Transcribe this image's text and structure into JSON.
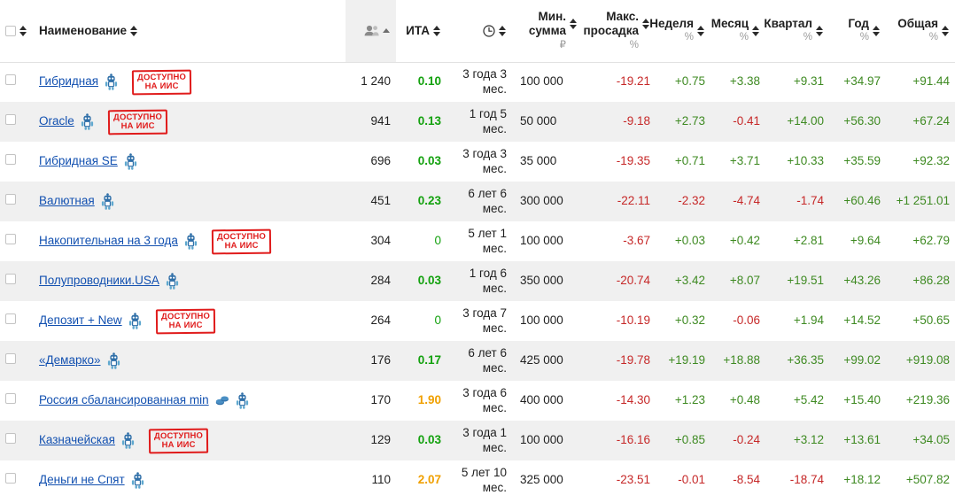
{
  "table": {
    "columns": [
      {
        "key": "select",
        "label": "",
        "sort": "both",
        "align": "left"
      },
      {
        "key": "name",
        "label": "Наименование",
        "sub": "",
        "sort": "both",
        "align": "left"
      },
      {
        "key": "people",
        "label": "",
        "icon": "people-icon",
        "sub": "",
        "sort": "asc",
        "align": "right",
        "sorted": true
      },
      {
        "key": "ita",
        "label": "ИТА",
        "sub": "",
        "sort": "both",
        "align": "right"
      },
      {
        "key": "term",
        "label": "",
        "icon": "clock-icon",
        "sub": "",
        "sort": "both",
        "align": "right"
      },
      {
        "key": "minsum",
        "label": "Мин. сумма",
        "sub": "₽",
        "sort": "both",
        "align": "right"
      },
      {
        "key": "maxdraw",
        "label": "Макс. просадка",
        "sub": "%",
        "sort": "both",
        "align": "right"
      },
      {
        "key": "week",
        "label": "Неделя",
        "sub": "%",
        "sort": "both",
        "align": "right"
      },
      {
        "key": "month",
        "label": "Месяц",
        "sub": "%",
        "sort": "both",
        "align": "right"
      },
      {
        "key": "quarter",
        "label": "Квартал",
        "sub": "%",
        "sort": "both",
        "align": "right"
      },
      {
        "key": "year",
        "label": "Год",
        "sub": "%",
        "sort": "both",
        "align": "right"
      },
      {
        "key": "total",
        "label": "Общая",
        "sub": "%",
        "sort": "both",
        "align": "right"
      }
    ],
    "badge_label_line1": "ДОСТУПНО",
    "badge_label_line2": "НА ИИС",
    "rows": [
      {
        "name": "Гибридная",
        "robot": true,
        "coins": false,
        "iis": true,
        "people": "1 240",
        "ita": "0.10",
        "ita_color": "green",
        "term": "3 года 3 мес.",
        "minsum": "100 000",
        "maxdraw": "-19.21",
        "week": "+0.75",
        "month": "+3.38",
        "quarter": "+9.31",
        "year": "+34.97",
        "total": "+91.44"
      },
      {
        "name": "Oracle",
        "robot": true,
        "coins": false,
        "iis": true,
        "people": "941",
        "ita": "0.13",
        "ita_color": "green",
        "term": "1 год 5 мес.",
        "minsum": "50 000",
        "maxdraw": "-9.18",
        "week": "+2.73",
        "month": "-0.41",
        "quarter": "+14.00",
        "year": "+56.30",
        "total": "+67.24"
      },
      {
        "name": "Гибридная SE",
        "robot": true,
        "coins": false,
        "iis": false,
        "people": "696",
        "ita": "0.03",
        "ita_color": "green",
        "term": "3 года 3 мес.",
        "minsum": "35 000",
        "maxdraw": "-19.35",
        "week": "+0.71",
        "month": "+3.71",
        "quarter": "+10.33",
        "year": "+35.59",
        "total": "+92.32"
      },
      {
        "name": "Валютная",
        "robot": true,
        "coins": false,
        "iis": false,
        "people": "451",
        "ita": "0.23",
        "ita_color": "green",
        "term": "6 лет 6 мес.",
        "minsum": "300 000",
        "maxdraw": "-22.11",
        "week": "-2.32",
        "month": "-4.74",
        "quarter": "-1.74",
        "year": "+60.46",
        "total": "+1 251.01"
      },
      {
        "name": "Накопительная на 3 года",
        "robot": true,
        "coins": false,
        "iis": true,
        "people": "304",
        "ita": "0",
        "ita_color": "green",
        "term": "5 лет 1 мес.",
        "minsum": "100 000",
        "maxdraw": "-3.67",
        "week": "+0.03",
        "month": "+0.42",
        "quarter": "+2.81",
        "year": "+9.64",
        "total": "+62.79"
      },
      {
        "name": "Полупроводники.USA",
        "robot": true,
        "coins": false,
        "iis": false,
        "people": "284",
        "ita": "0.03",
        "ita_color": "green",
        "term": "1 год 6 мес.",
        "minsum": "350 000",
        "maxdraw": "-20.74",
        "week": "+3.42",
        "month": "+8.07",
        "quarter": "+19.51",
        "year": "+43.26",
        "total": "+86.28"
      },
      {
        "name": "Депозит + New",
        "robot": true,
        "coins": false,
        "iis": true,
        "people": "264",
        "ita": "0",
        "ita_color": "green",
        "term": "3 года 7 мес.",
        "minsum": "100 000",
        "maxdraw": "-10.19",
        "week": "+0.32",
        "month": "-0.06",
        "quarter": "+1.94",
        "year": "+14.52",
        "total": "+50.65"
      },
      {
        "name": "«Демарко»",
        "robot": true,
        "coins": false,
        "iis": false,
        "people": "176",
        "ita": "0.17",
        "ita_color": "green",
        "term": "6 лет 6 мес.",
        "minsum": "425 000",
        "maxdraw": "-19.78",
        "week": "+19.19",
        "month": "+18.88",
        "quarter": "+36.35",
        "year": "+99.02",
        "total": "+919.08"
      },
      {
        "name": "Россия сбалансированная min",
        "robot": true,
        "coins": true,
        "iis": false,
        "people": "170",
        "ita": "1.90",
        "ita_color": "orange",
        "term": "3 года 6 мес.",
        "minsum": "400 000",
        "maxdraw": "-14.30",
        "week": "+1.23",
        "month": "+0.48",
        "quarter": "+5.42",
        "year": "+15.40",
        "total": "+219.36"
      },
      {
        "name": "Казначейская",
        "robot": true,
        "coins": false,
        "iis": true,
        "people": "129",
        "ita": "0.03",
        "ita_color": "green",
        "term": "3 года 1 мес.",
        "minsum": "100 000",
        "maxdraw": "-16.16",
        "week": "+0.85",
        "month": "-0.24",
        "quarter": "+3.12",
        "year": "+13.61",
        "total": "+34.05"
      },
      {
        "name": "Деньги не Спят",
        "robot": true,
        "coins": false,
        "iis": false,
        "people": "110",
        "ita": "2.07",
        "ita_color": "orange",
        "term": "5 лет 10 мес.",
        "minsum": "325 000",
        "maxdraw": "-23.51",
        "week": "-0.01",
        "month": "-8.54",
        "quarter": "-18.74",
        "year": "+18.12",
        "total": "+507.82"
      }
    ]
  },
  "colors": {
    "positive": "#3e8a22",
    "negative": "#c62828",
    "link": "#1250b0",
    "badge": "#e01b1b",
    "ita_green": "#13a10e",
    "ita_orange": "#f0a000",
    "row_stripe": "#f0f0f0",
    "sorted_header": "#f0f0f0"
  }
}
